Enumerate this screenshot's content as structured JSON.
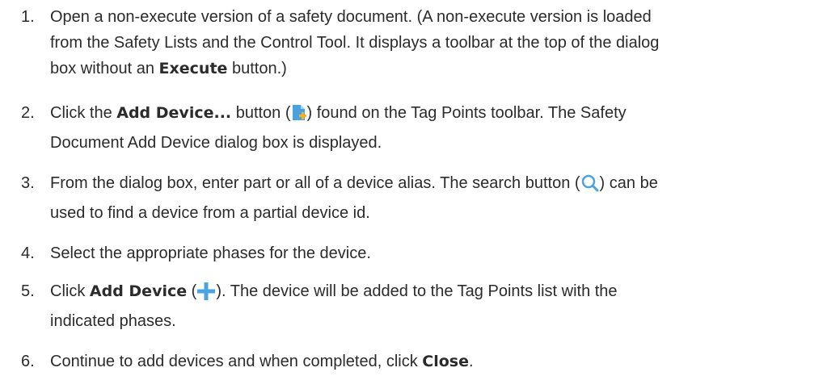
{
  "steps": [
    {
      "number": "1.",
      "lines": [
        "Open a non-execute version of a safety document. (A non-execute version is loaded",
        "from the Safety Lists and the Control Tool. It displays a toolbar at the top of the dialog"
      ],
      "line3_prefix": "box without an ",
      "execute_label": "Execute",
      "line3_suffix": " button.)"
    },
    {
      "number": "2.",
      "line1_prefix": "Click the ",
      "add_device_label": "Add Device...",
      "line1_mid": " button (",
      "line1_suffix": ") found on the Tag Points toolbar. The Safety",
      "line2": "Document Add Device dialog box is displayed."
    },
    {
      "number": "3.",
      "line1_prefix": "From the dialog box, enter part or all of a device alias. The search button (",
      "line1_suffix": ") can be",
      "line2": "used to find a device from a partial device id."
    },
    {
      "number": "4.",
      "line1": "Select the appropriate phases for the device."
    },
    {
      "number": "5.",
      "line1_prefix": "Click ",
      "add_device_label": "Add Device",
      "line1_mid": " (",
      "line1_suffix": "). The device will be added to the Tag Points list with the",
      "line2": "indicated phases."
    },
    {
      "number": "6.",
      "line1_prefix": "Continue to add devices and when completed, click ",
      "close_label": "Close",
      "line1_suffix": "."
    }
  ],
  "icons": {
    "add_device_toolbar": "add-document-icon",
    "search": "search-icon",
    "add": "plus-icon"
  },
  "colors": {
    "text": "#2b2b2b",
    "icon_blue": "#4aa3df",
    "icon_orange": "#f5b324"
  }
}
